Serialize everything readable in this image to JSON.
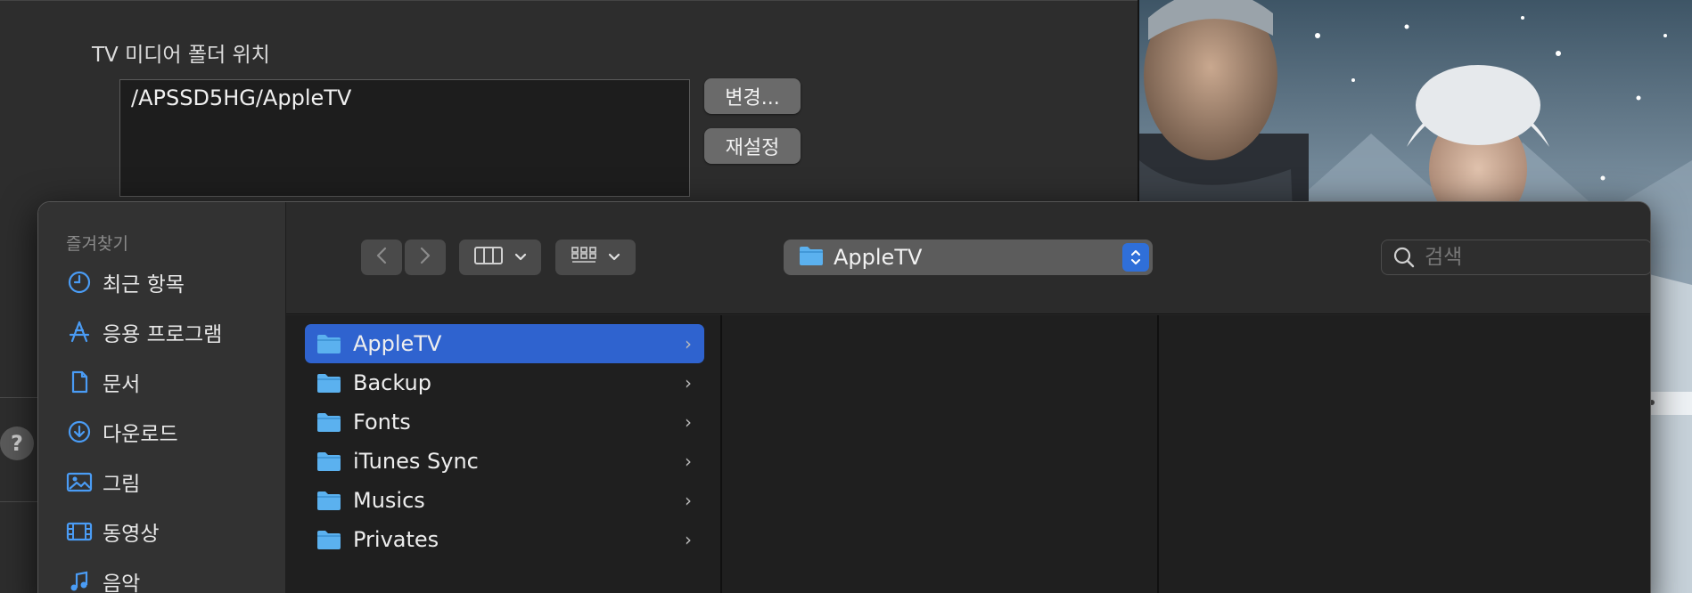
{
  "prefs": {
    "media_folder_label": "TV 미디어 폴더 위치",
    "media_folder_path": "/APSSD5HG/AppleTV",
    "change_button": "변경...",
    "reset_button": "재설정",
    "help_button": "?"
  },
  "sidebar": {
    "section_title": "즐겨찾기",
    "items": [
      {
        "label": "최근 항목",
        "icon": "clock-icon"
      },
      {
        "label": "응용 프로그램",
        "icon": "applications-icon"
      },
      {
        "label": "문서",
        "icon": "document-icon"
      },
      {
        "label": "다운로드",
        "icon": "download-icon"
      },
      {
        "label": "그림",
        "icon": "photo-icon"
      },
      {
        "label": "동영상",
        "icon": "film-icon"
      },
      {
        "label": "음악",
        "icon": "music-icon"
      }
    ]
  },
  "toolbar": {
    "location": "AppleTV",
    "search_placeholder": "검색"
  },
  "browser": {
    "column1": [
      {
        "label": "AppleTV",
        "selected": true
      },
      {
        "label": "Backup",
        "selected": false
      },
      {
        "label": "Fonts",
        "selected": false
      },
      {
        "label": "iTunes Sync",
        "selected": false
      },
      {
        "label": "Musics",
        "selected": false
      },
      {
        "label": "Privates",
        "selected": false
      }
    ]
  },
  "colors": {
    "accent": "#2f63cf",
    "sidebar_icon": "#4a9cf5",
    "folder": "#5bb1ef"
  }
}
